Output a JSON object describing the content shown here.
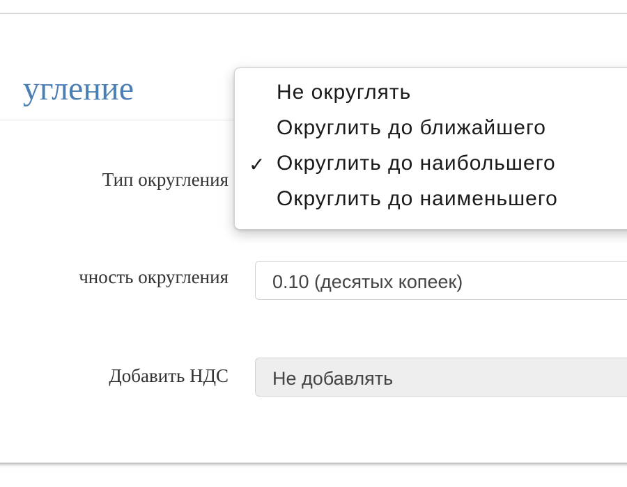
{
  "section": {
    "title": "угление"
  },
  "form": {
    "rounding_type_label": "Тип округления",
    "precision_label": "чность округления",
    "precision_value": "0.10 (десятых копеек)",
    "vat_label": "Добавить НДС",
    "vat_value": "Не добавлять"
  },
  "dropdown": {
    "check_mark": "✓",
    "options": [
      {
        "label": "Не округлять",
        "selected": false
      },
      {
        "label": "Округлить до ближайшего",
        "selected": false
      },
      {
        "label": "Округлить до наибольшего",
        "selected": true
      },
      {
        "label": "Округлить до наименьшего",
        "selected": false
      }
    ]
  },
  "colors": {
    "title": "#4a7fb5",
    "disabled_field": "#eeeeee"
  }
}
